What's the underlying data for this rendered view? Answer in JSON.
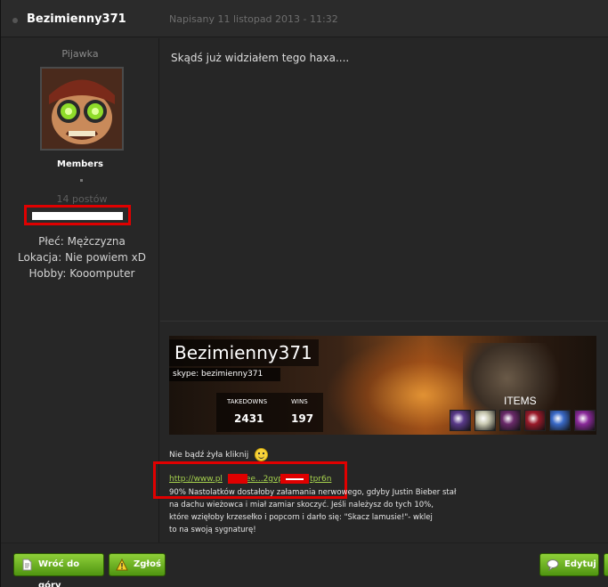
{
  "post": {
    "author": "Bezimienny371",
    "date": "Napisany 11 listopad 2013 - 11:32",
    "body": "Skądś już widziałem tego haxa...."
  },
  "sidebar": {
    "rank_title": "Pijawka",
    "group": "Members",
    "post_count": "14 postów",
    "fields": [
      {
        "label": "Płeć: Mężczyzna"
      },
      {
        "label": "Lokacja: Nie powiem xD"
      },
      {
        "label": "Hobby: Kooomputer"
      }
    ]
  },
  "signature": {
    "banner": {
      "name": "Bezimienny371",
      "skype": "skype: bezimienny371",
      "takedowns_label": "TAKEDOWNS",
      "wins_label": "WINS",
      "takedowns": "2431",
      "wins": "197",
      "items_label": "ITEMS",
      "item_colors": [
        "#5a3a8a",
        "#c8c8b0",
        "#6a2a6a",
        "#9a1a2a",
        "#3a6ac8",
        "#8a2a9a"
      ]
    },
    "cta": "Nie bądź żyła kliknij",
    "link_prefix": "http://www.pl",
    "link_mid": "ee...2gvp",
    "link_suffix": "tpr6n",
    "lines": [
      "90% Nastolatków dostałoby załamania nerwowego, gdyby Justin Bieber stał",
      "na dachu wieżowca i miał zamiar skoczyć. Jeśli należysz do tych 10%,",
      "które wzięłoby krzesełko i popcorn i darło się: \"Skacz lamusie!\"- wklej",
      "to na swoją sygnaturę!"
    ]
  },
  "footer": {
    "back_to_top": "Wróć do góry",
    "report": "Zgłoś",
    "edit": "Edytuj"
  },
  "colors": {
    "accent_green": "#6fb324",
    "redaction": "#e00000",
    "link": "#a6d24e"
  }
}
